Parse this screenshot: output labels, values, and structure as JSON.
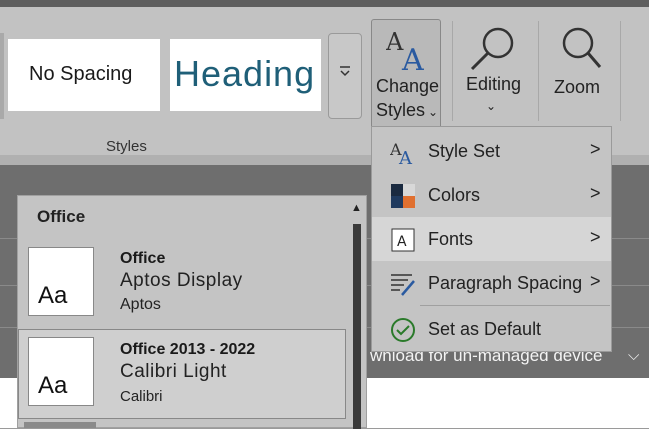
{
  "ribbon": {
    "styles_group": {
      "label": "Styles",
      "tiles": [
        "No Spacing",
        "Heading"
      ],
      "more_icon": "gallery-more-icon"
    },
    "change_styles": {
      "line1": "Change",
      "line2": "Styles",
      "caret": "⌄",
      "icon": "change-styles-icon"
    },
    "editing": {
      "label": "Editing",
      "caret": "⌄",
      "icon": "magnifier-icon"
    },
    "zoom": {
      "label": "Zoom",
      "icon": "magnifier-icon"
    }
  },
  "change_styles_menu": {
    "items": [
      {
        "label": "Style Set",
        "icon": "style-set-icon",
        "submenu": true
      },
      {
        "label": "Colors",
        "icon": "colors-icon",
        "submenu": true
      },
      {
        "label": "Fonts",
        "icon": "fonts-icon",
        "submenu": true,
        "highlighted": true
      },
      {
        "label": "Paragraph Spacing",
        "icon": "paragraph-spacing-icon",
        "submenu": true
      },
      {
        "label": "Set as Default",
        "icon": "checkmark-circle-icon",
        "submenu": false
      }
    ],
    "submenu_arrow": ">"
  },
  "fonts_gallery": {
    "header": "Office",
    "items": [
      {
        "thumb": "Aa",
        "name": "Office",
        "heading_font": "Aptos Display",
        "body_font": "Aptos"
      },
      {
        "thumb": "Aa",
        "name": "Office 2013 - 2022",
        "heading_font": "Calibri Light",
        "body_font": "Calibri",
        "selected": true
      }
    ]
  },
  "document": {
    "banner_text": "wnload for un-managed device",
    "banner_chevron": "⌵"
  },
  "colors": {
    "heading_style": "#1f5f78",
    "theme_dark": "#1f3a5f",
    "theme_orange": "#e07030",
    "check_green": "#2a7a2a",
    "accent_blue": "#2a5aa0"
  }
}
